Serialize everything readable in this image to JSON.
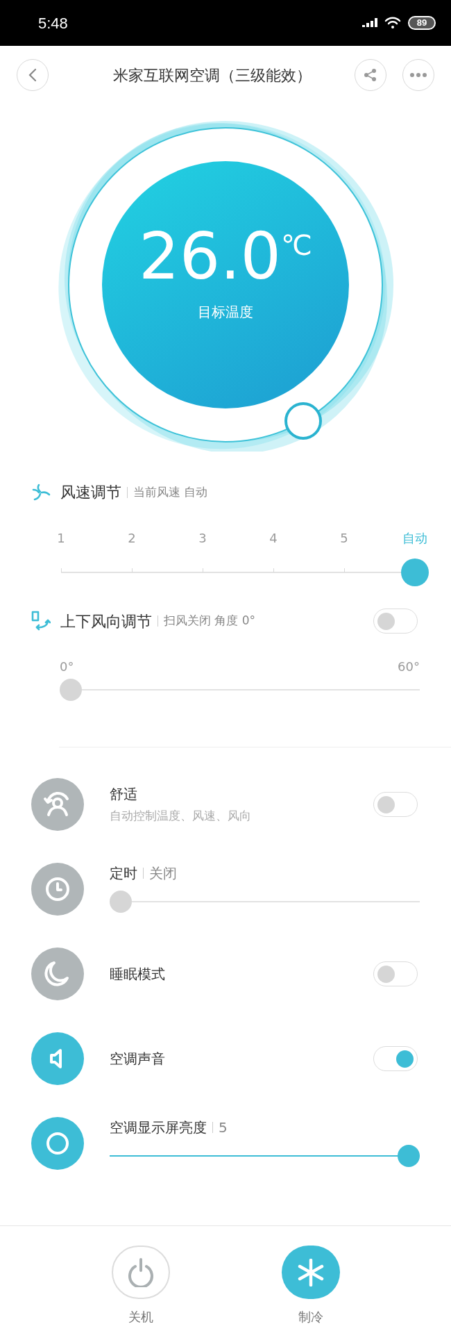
{
  "status_bar": {
    "time": "5:48",
    "battery": "89"
  },
  "header": {
    "title": "米家互联网空调（三级能效）"
  },
  "dial": {
    "temperature": "26.0",
    "unit": "℃",
    "label": "目标温度"
  },
  "fan_speed": {
    "title": "风速调节",
    "subtitle": "当前风速 自动",
    "options": [
      {
        "label": "1",
        "selected": false
      },
      {
        "label": "2",
        "selected": false
      },
      {
        "label": "3",
        "selected": false
      },
      {
        "label": "4",
        "selected": false
      },
      {
        "label": "5",
        "selected": false
      },
      {
        "label": "自动",
        "selected": true
      }
    ]
  },
  "swing": {
    "title": "上下风向调节",
    "subtitle": "扫风关闭 角度 0°",
    "on": false,
    "min_label": "0°",
    "max_label": "60°",
    "level": 0
  },
  "settings": [
    {
      "kind": "toggle",
      "title": "舒适",
      "description": "自动控制温度、风速、风向",
      "on": false
    },
    {
      "kind": "slider",
      "title": "定时",
      "value": "关闭",
      "level": 0
    },
    {
      "kind": "toggle",
      "title": "睡眠模式",
      "on": false
    },
    {
      "kind": "toggle",
      "title": "空调声音",
      "on": true
    },
    {
      "kind": "slider",
      "title": "空调显示屏亮度",
      "value": "5",
      "level": 1
    }
  ],
  "modes": [
    {
      "label": "关机",
      "selected": false
    },
    {
      "label": "制冷",
      "selected": true
    }
  ]
}
